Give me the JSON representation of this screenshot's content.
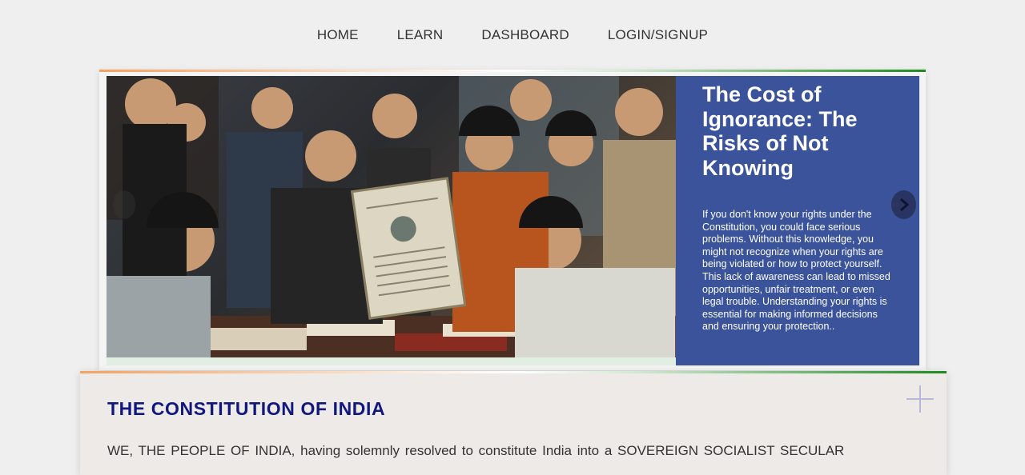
{
  "nav": {
    "items": [
      {
        "label": "HOME"
      },
      {
        "label": "LEARN"
      },
      {
        "label": "DASHBOARD"
      },
      {
        "label": "LOGIN/SIGNUP"
      }
    ]
  },
  "hero": {
    "title": "The Cost of Ignorance: The Risks of Not Knowing",
    "text": "If you don't know your rights under the Constitution, you could face serious problems. Without this knowledge, you might not recognize when your rights are being violated or how to protect yourself. This lack of awareness can lead to missed opportunities, unfair treatment, or even legal trouble. Understanding your rights is essential for making informed decisions and ensuring your protection..",
    "next_icon": "chevron-right-icon",
    "panel_color": "#3a539b"
  },
  "card": {
    "title": "THE CONSTITUTION OF INDIA",
    "body": "WE, THE PEOPLE OF INDIA, having solemnly resolved to constitute India into a SOVEREIGN SOCIALIST SECULAR",
    "toggle_icon": "plus-icon",
    "title_color": "#10177f"
  }
}
